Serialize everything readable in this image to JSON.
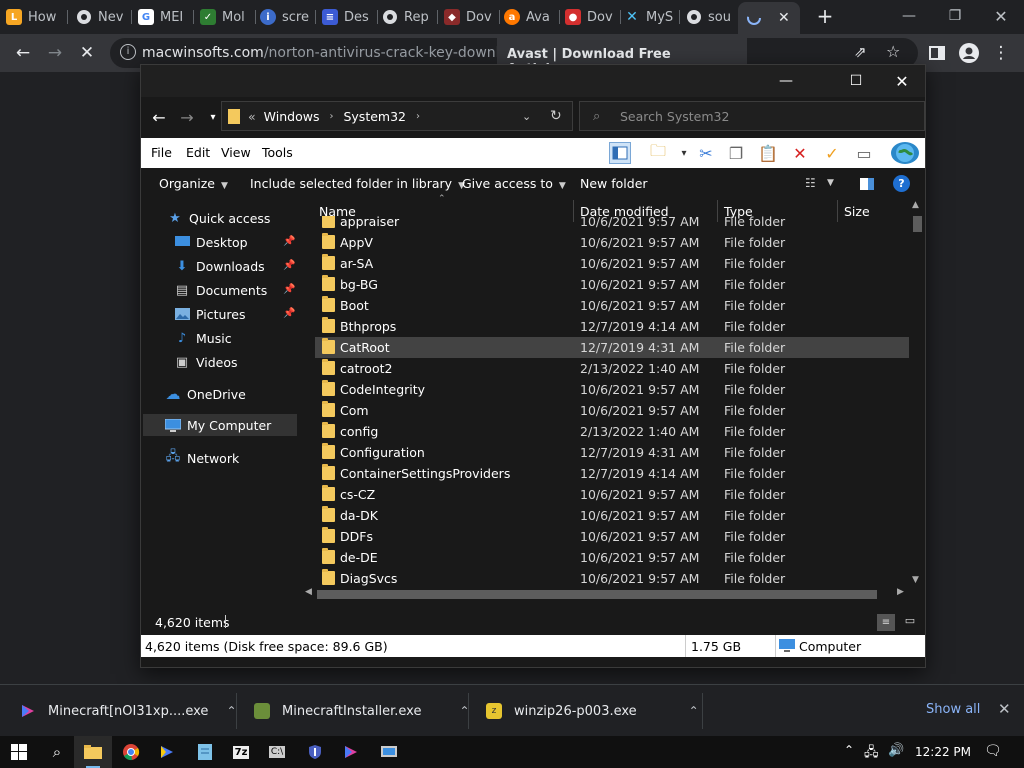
{
  "browser": {
    "tabs": [
      {
        "label": "How",
        "favicon": "L",
        "color": "#f6a623"
      },
      {
        "label": "Nev",
        "favicon": "chrome-icon",
        "color": "#5f6368"
      },
      {
        "label": "MEI",
        "favicon": "G",
        "color": "#ffffff"
      },
      {
        "label": "Mol",
        "favicon": "shield-check-icon",
        "color": "#2e7d32"
      },
      {
        "label": "scre",
        "favicon": "i",
        "color": "#3c6bc9"
      },
      {
        "label": "Des",
        "favicon": "doc-icon",
        "color": "#3c5bd4"
      },
      {
        "label": "Rep",
        "favicon": "chrome-icon",
        "color": "#5f6368"
      },
      {
        "label": "Dov",
        "favicon": "game-icon",
        "color": "#b33"
      },
      {
        "label": "Ava",
        "favicon": "avast-icon",
        "color": "#ff7800"
      },
      {
        "label": "Dov",
        "favicon": "red-icon",
        "color": "#d32f2f"
      },
      {
        "label": "MyS",
        "favicon": "x-icon",
        "color": "#1e88a8"
      },
      {
        "label": "sou",
        "favicon": "chrome-icon",
        "color": "#5f6368"
      }
    ],
    "address": {
      "host": "macwinsofts.com",
      "path": "/norton-antivirus-crack-key-download/"
    },
    "tooltip_title": "Avast | Download Free Antivirus or",
    "new_tab_label": "+"
  },
  "explorer": {
    "breadcrumb": [
      "Windows",
      "System32"
    ],
    "breadcrumb_prefix": "«",
    "search_placeholder": "Search System32",
    "menu": [
      "File",
      "Edit",
      "View",
      "Tools"
    ],
    "commands": [
      {
        "label": "Organize",
        "dropdown": true
      },
      {
        "label": "Include selected folder in library",
        "dropdown": true
      },
      {
        "label": "Give access to",
        "dropdown": true
      },
      {
        "label": "New folder",
        "dropdown": false
      }
    ],
    "nav": [
      {
        "label": "Quick access",
        "icon": "star-icon",
        "pinned": false
      },
      {
        "label": "Desktop",
        "icon": "desktop-icon",
        "pinned": true
      },
      {
        "label": "Downloads",
        "icon": "download-icon",
        "pinned": true
      },
      {
        "label": "Documents",
        "icon": "documents-icon",
        "pinned": true
      },
      {
        "label": "Pictures",
        "icon": "pictures-icon",
        "pinned": true
      },
      {
        "label": "Music",
        "icon": "music-icon",
        "pinned": false
      },
      {
        "label": "Videos",
        "icon": "videos-icon",
        "pinned": false
      },
      {
        "label": "OneDrive",
        "icon": "cloud-icon",
        "pinned": false
      },
      {
        "label": "My Computer",
        "icon": "computer-icon",
        "pinned": false,
        "selected": true
      },
      {
        "label": "Network",
        "icon": "network-icon",
        "pinned": false
      }
    ],
    "columns": [
      "Name",
      "Date modified",
      "Type",
      "Size"
    ],
    "files": [
      {
        "name": "appraiser",
        "date": "10/6/2021 9:57 AM",
        "type": "File folder"
      },
      {
        "name": "AppV",
        "date": "10/6/2021 9:57 AM",
        "type": "File folder"
      },
      {
        "name": "ar-SA",
        "date": "10/6/2021 9:57 AM",
        "type": "File folder"
      },
      {
        "name": "bg-BG",
        "date": "10/6/2021 9:57 AM",
        "type": "File folder"
      },
      {
        "name": "Boot",
        "date": "10/6/2021 9:57 AM",
        "type": "File folder"
      },
      {
        "name": "Bthprops",
        "date": "12/7/2019 4:14 AM",
        "type": "File folder"
      },
      {
        "name": "CatRoot",
        "date": "12/7/2019 4:31 AM",
        "type": "File folder",
        "selected": true
      },
      {
        "name": "catroot2",
        "date": "2/13/2022 1:40 AM",
        "type": "File folder"
      },
      {
        "name": "CodeIntegrity",
        "date": "10/6/2021 9:57 AM",
        "type": "File folder"
      },
      {
        "name": "Com",
        "date": "10/6/2021 9:57 AM",
        "type": "File folder"
      },
      {
        "name": "config",
        "date": "2/13/2022 1:40 AM",
        "type": "File folder"
      },
      {
        "name": "Configuration",
        "date": "12/7/2019 4:31 AM",
        "type": "File folder"
      },
      {
        "name": "ContainerSettingsProviders",
        "date": "12/7/2019 4:14 AM",
        "type": "File folder"
      },
      {
        "name": "cs-CZ",
        "date": "10/6/2021 9:57 AM",
        "type": "File folder"
      },
      {
        "name": "da-DK",
        "date": "10/6/2021 9:57 AM",
        "type": "File folder"
      },
      {
        "name": "DDFs",
        "date": "10/6/2021 9:57 AM",
        "type": "File folder"
      },
      {
        "name": "de-DE",
        "date": "10/6/2021 9:57 AM",
        "type": "File folder"
      },
      {
        "name": "DiagSvcs",
        "date": "10/6/2021 9:57 AM",
        "type": "File folder"
      }
    ],
    "status_count": "4,620 items",
    "status_detail": "4,620 items (Disk free space: 89.6 GB)",
    "status_size": "1.75 GB",
    "status_location": "Computer"
  },
  "downloads": {
    "items": [
      {
        "name": "Minecraft[nOI31xp....exe",
        "icon": "bluestacks-icon"
      },
      {
        "name": "MinecraftInstaller.exe",
        "icon": "minecraft-icon"
      },
      {
        "name": "winzip26-p003.exe",
        "icon": "winzip-icon"
      }
    ],
    "show_all": "Show all"
  },
  "taskbar": {
    "clock": "12:22 PM"
  },
  "colors": {
    "accent": "#8ab4f8",
    "folder": "#f4c95d",
    "selection": "#434343"
  }
}
